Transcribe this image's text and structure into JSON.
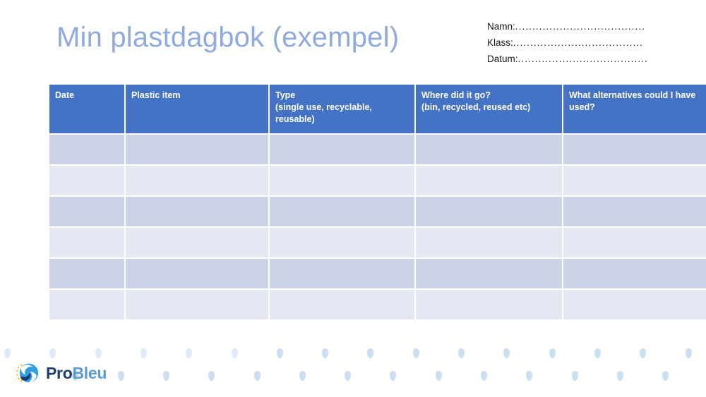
{
  "slide": {
    "title": "Min plastdagbok (exempel)",
    "title_color": "#8faadc",
    "background_color": "#ffffff"
  },
  "form": {
    "fields": [
      {
        "label": "Namn:",
        "dots": "......................................"
      },
      {
        "label": "Klass:",
        "dots": "......................................"
      },
      {
        "label": "Datum:",
        "dots": "......................................"
      }
    ]
  },
  "table": {
    "header_color": "#4472c4",
    "row_color_dark": "#ccd2e6",
    "row_color_light": "#e5e8f2",
    "columns": [
      {
        "label": "Date"
      },
      {
        "label": "Plastic item"
      },
      {
        "label": "Type\n(single use, recyclable, reusable)"
      },
      {
        "label": "Where did it go?\n(bin, recycled, reused etc)"
      },
      {
        "label": "What alternatives could I have used?"
      }
    ],
    "rows": [
      {
        "shade": "dark",
        "cells": [
          "",
          "",
          "",
          "",
          ""
        ]
      },
      {
        "shade": "light",
        "cells": [
          "",
          "",
          "",
          "",
          ""
        ]
      },
      {
        "shade": "dark",
        "cells": [
          "",
          "",
          "",
          "",
          ""
        ]
      },
      {
        "shade": "light",
        "cells": [
          "",
          "",
          "",
          "",
          ""
        ]
      },
      {
        "shade": "dark",
        "cells": [
          "",
          "",
          "",
          "",
          ""
        ]
      },
      {
        "shade": "light",
        "cells": [
          "",
          "",
          "",
          "",
          ""
        ]
      }
    ]
  },
  "logo": {
    "name_part_one": "Pro",
    "name_part_two": "Bleu",
    "color_dark": "#1b3e6f",
    "color_light": "#5b9bd5",
    "mark_icon": "blue-circle-wave-icon",
    "stars_icon": "yellow-stars-icon"
  },
  "decoration": {
    "droplet_color": "#c3d8f2",
    "droplet_icon": "water-droplet-icon"
  }
}
